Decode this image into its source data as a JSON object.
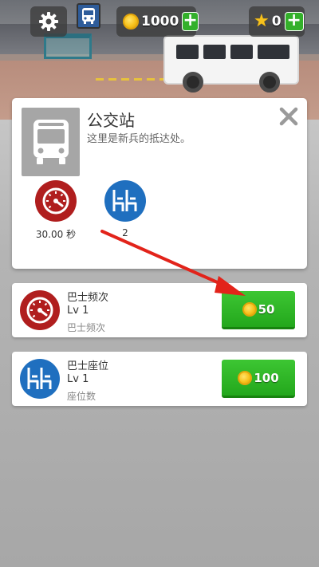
{
  "hud": {
    "coins": "1000",
    "stars": "0",
    "coin_plus": "+",
    "star_plus": "+"
  },
  "info_panel": {
    "title": "公交站",
    "subtitle": "这里是新兵的抵达处。",
    "stats": [
      {
        "icon": "speedometer-icon",
        "value": "30.00 秒"
      },
      {
        "icon": "bus-seats-icon",
        "value": "2"
      }
    ]
  },
  "upgrades": [
    {
      "icon": "speedometer-icon",
      "name": "巴士频次",
      "level": "Lv 1",
      "description": "巴士频次",
      "price": "50"
    },
    {
      "icon": "bus-seats-icon",
      "name": "巴士座位",
      "level": "Lv 1",
      "description": "座位数",
      "price": "100"
    }
  ],
  "colors": {
    "speed_red": "#b01e1e",
    "seat_blue": "#1f6fbf",
    "buy_green": "#2fb428",
    "arrow_red": "#e2231a"
  }
}
